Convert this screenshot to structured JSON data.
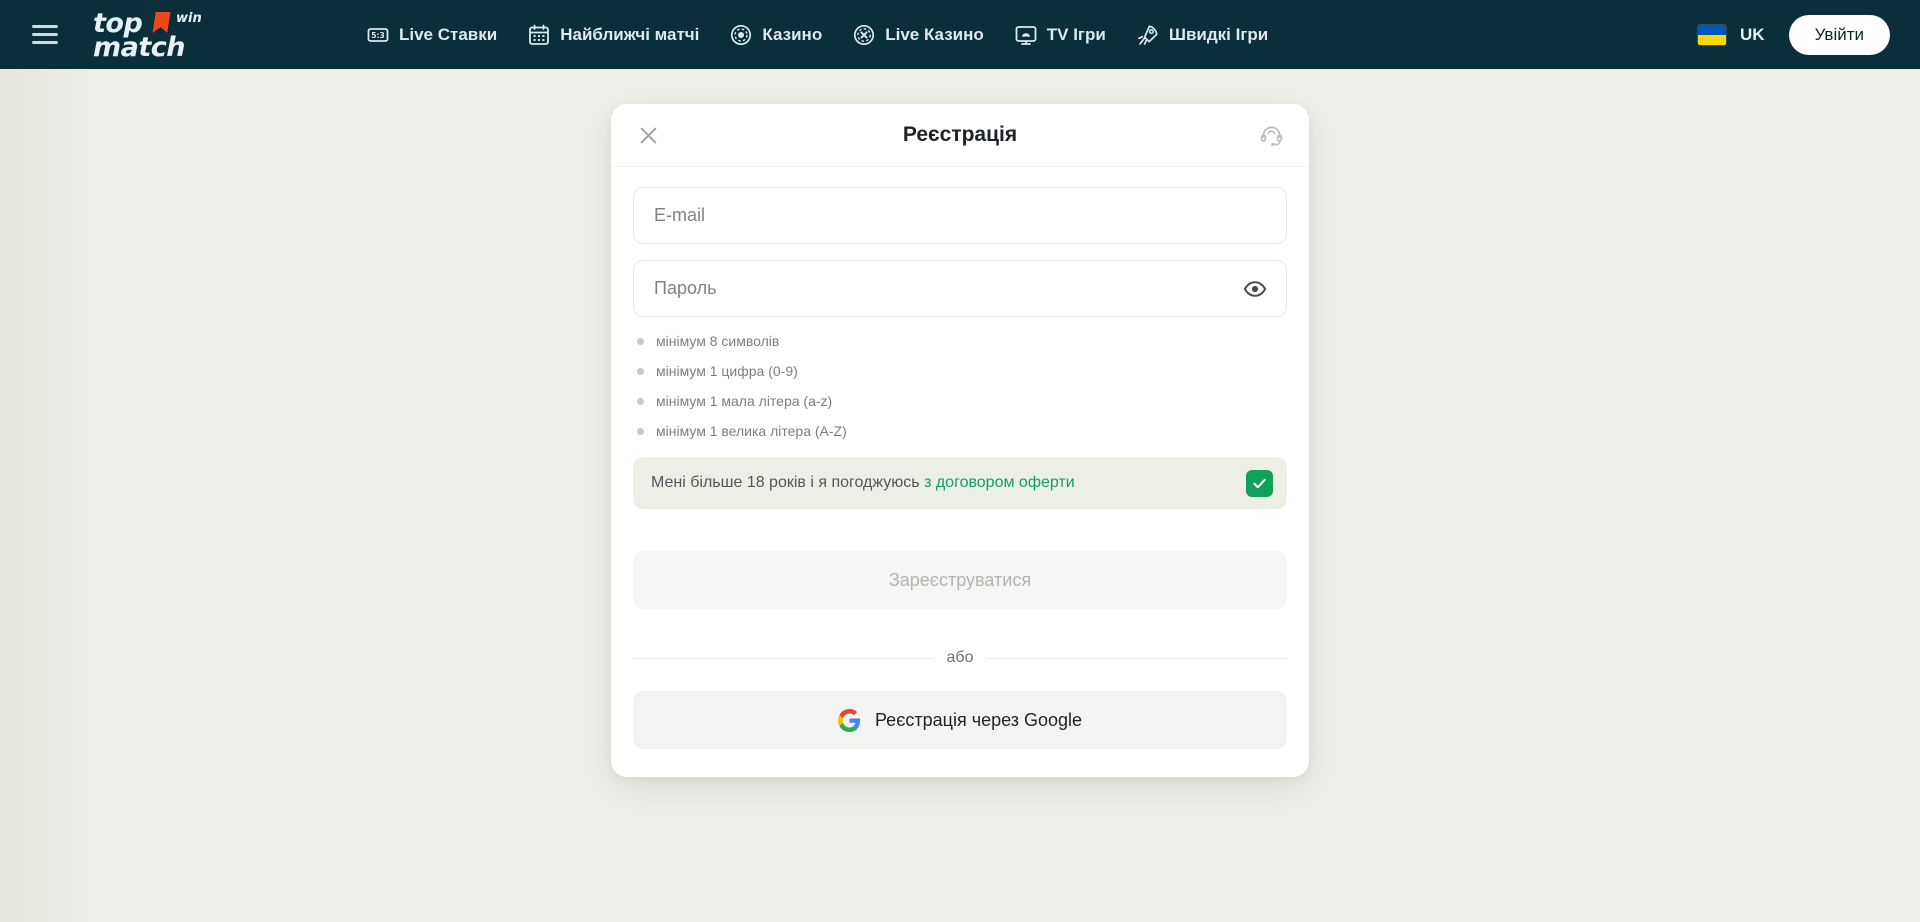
{
  "header": {
    "menu_icon": "hamburger-menu-icon",
    "logo": {
      "top": "top",
      "win": "win",
      "bottom": "match",
      "flag_icon": "bookmark-flag-icon"
    },
    "nav": [
      {
        "label": "Live Ставки",
        "icon": "live-scoreboard-icon",
        "icon_text": "5:3"
      },
      {
        "label": "Найближчі матчі",
        "icon": "calendar-icon"
      },
      {
        "label": "Казино",
        "icon": "casino-chip-icon"
      },
      {
        "label": "Live Казино",
        "icon": "live-casino-chip-icon"
      },
      {
        "label": "TV Ігри",
        "icon": "tv-gamepad-icon"
      },
      {
        "label": "Швидкі Ігри",
        "icon": "rocket-icon"
      }
    ],
    "language": {
      "label": "UK",
      "flag_icon": "ukraine-flag-icon"
    },
    "login_label": "Увійти"
  },
  "modal": {
    "title": "Реєстрація",
    "close_icon": "close-x-icon",
    "support_icon": "headset-support-icon",
    "email": {
      "placeholder": "E-mail",
      "value": ""
    },
    "password": {
      "placeholder": "Пароль",
      "value": "",
      "toggle_icon": "eye-icon"
    },
    "requirements": [
      "мінімум 8 символів",
      "мінімум 1 цифра (0-9)",
      "мінімум 1 мала літера (a-z)",
      "мінімум 1 велика літера (A-Z)"
    ],
    "consent": {
      "text": "Мені більше 18 років і я погоджуюсь ",
      "link": "з договором оферти",
      "checked": true,
      "check_icon": "checkmark-icon"
    },
    "submit_label": "Зареєструватися",
    "divider_label": "або",
    "google_label": "Реєстрація через Google",
    "google_icon": "google-g-icon"
  },
  "colors": {
    "header_bg": "#0b2e3b",
    "page_bg": "#efefe9",
    "accent_green": "#12a05d",
    "logo_accent": "#f0461e"
  }
}
